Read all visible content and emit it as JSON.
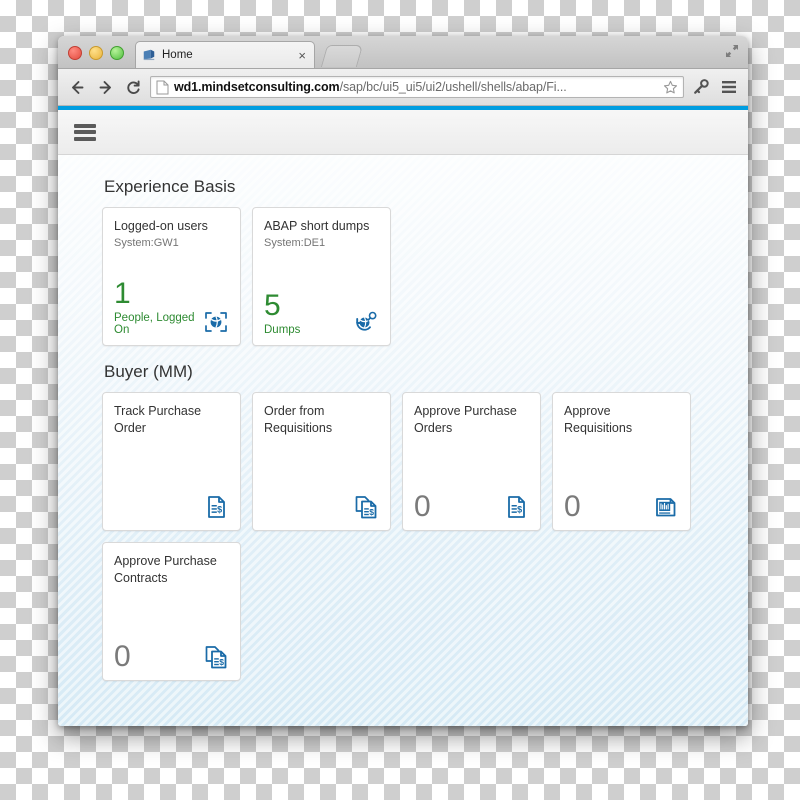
{
  "browser": {
    "tab": {
      "title": "Home",
      "favicon": "page-favicon",
      "close_label": "×"
    },
    "new_tab_label": "",
    "nav": {
      "back": "←",
      "forward": "→",
      "reload": "↻"
    },
    "url": {
      "host": "wd1.mindsetconsulting.com",
      "path": "/sap/bc/ui5_ui5/ui2/ushell/shells/abap/Fi...",
      "full": "wd1.mindsetconsulting.com/sap/bc/ui5_ui5/ui2/ushell/shells/abap/Fi..."
    },
    "icons": {
      "star": "star-icon",
      "key": "key-icon",
      "menu": "hamburger-menu-icon",
      "maximize": "maximize-icon"
    },
    "window_controls": [
      "close",
      "minimize",
      "zoom"
    ]
  },
  "shell": {
    "accent_color": "#009de0",
    "menu_icon": "hamburger-menu-icon"
  },
  "groups": [
    {
      "title": "Experience Basis",
      "tiles": [
        {
          "title": "Logged-on users",
          "subtitle": "System:GW1",
          "number": "1",
          "unit": "People, Logged On",
          "number_color": "green",
          "icon": "globe-connected-icon"
        },
        {
          "title": "ABAP short dumps",
          "subtitle": "System:DE1",
          "number": "5",
          "unit": "Dumps",
          "number_color": "green",
          "icon": "globe-search-icon"
        }
      ]
    },
    {
      "title": "Buyer (MM)",
      "tiles": [
        {
          "title": "Track Purchase Order",
          "subtitle": "",
          "number": "",
          "unit": "",
          "number_color": "grey",
          "icon": "document-dollar-icon"
        },
        {
          "title": "Order from Requisitions",
          "subtitle": "",
          "number": "",
          "unit": "",
          "number_color": "grey",
          "icon": "documents-dollar-icon"
        },
        {
          "title": "Approve Purchase Orders",
          "subtitle": "",
          "number": "0",
          "unit": "",
          "number_color": "grey",
          "icon": "document-dollar-icon"
        },
        {
          "title": "Approve Requisitions",
          "subtitle": "",
          "number": "0",
          "unit": "",
          "number_color": "grey",
          "icon": "document-barchart-icon"
        },
        {
          "title": "Approve Purchase Contracts",
          "subtitle": "",
          "number": "0",
          "unit": "",
          "number_color": "grey",
          "icon": "documents-dollar-icon"
        }
      ]
    }
  ],
  "colors": {
    "accent": "#009de0",
    "icon_blue": "#1a6ba8",
    "kpi_green": "#2e8b32",
    "kpi_grey": "#7a7a7a"
  }
}
